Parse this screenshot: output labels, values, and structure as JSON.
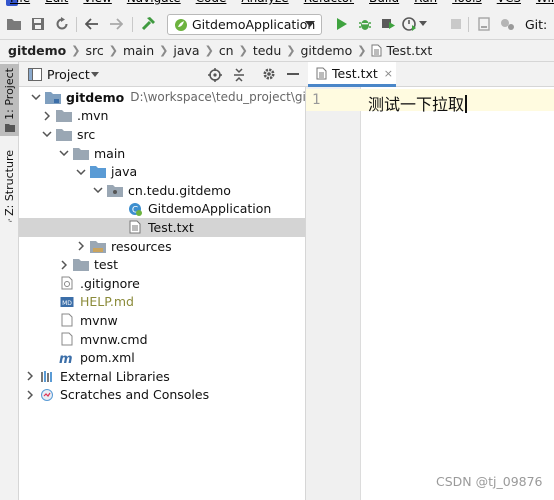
{
  "menu": {
    "items": [
      "File",
      "Edit",
      "View",
      "Navigate",
      "Code",
      "Analyze",
      "Refactor",
      "Build",
      "Run",
      "Tools",
      "VCS",
      "Window",
      "He"
    ]
  },
  "toolbar": {
    "run_config": "GitdemoApplication",
    "git_label": "Git:"
  },
  "breadcrumb": [
    "gitdemo",
    "src",
    "main",
    "java",
    "cn",
    "tedu",
    "gitdemo",
    "Test.txt"
  ],
  "side_tabs": {
    "project": "1: Project",
    "structure": "Z: Structure"
  },
  "project_panel": {
    "title": "Project",
    "tree": [
      {
        "label": "gitdemo",
        "path": "D:\\workspace\\tedu_project\\gitdemo",
        "icon": "module-folder-icon",
        "bold": true
      },
      {
        "label": ".mvn",
        "icon": "folder-icon"
      },
      {
        "label": "src",
        "icon": "folder-icon"
      },
      {
        "label": "main",
        "icon": "folder-icon"
      },
      {
        "label": "java",
        "icon": "source-folder-icon"
      },
      {
        "label": "cn.tedu.gitdemo",
        "icon": "package-icon"
      },
      {
        "label": "GitdemoApplication",
        "icon": "spring-class-icon"
      },
      {
        "label": "Test.txt",
        "icon": "text-file-icon"
      },
      {
        "label": "resources",
        "icon": "resources-folder-icon"
      },
      {
        "label": "test",
        "icon": "folder-icon"
      },
      {
        "label": ".gitignore",
        "icon": "gitignore-file-icon"
      },
      {
        "label": "HELP.md",
        "icon": "markdown-file-icon"
      },
      {
        "label": "mvnw",
        "icon": "file-icon"
      },
      {
        "label": "mvnw.cmd",
        "icon": "file-icon"
      },
      {
        "label": "pom.xml",
        "icon": "maven-file-icon"
      },
      {
        "label": "External Libraries",
        "icon": "libraries-icon"
      },
      {
        "label": "Scratches and Consoles",
        "icon": "scratches-icon"
      }
    ]
  },
  "editor": {
    "tab_label": "Test.txt",
    "tab_close": "×",
    "line_number": "1",
    "content": "测试一下拉取"
  },
  "watermark": "CSDN @tj_09876",
  "colors": {
    "accent": "#4a86c8",
    "run_green": "#3fa33f",
    "debug_green": "#48a348",
    "folder_blue": "#5a9bd5",
    "selection": "#d4d4d4"
  }
}
